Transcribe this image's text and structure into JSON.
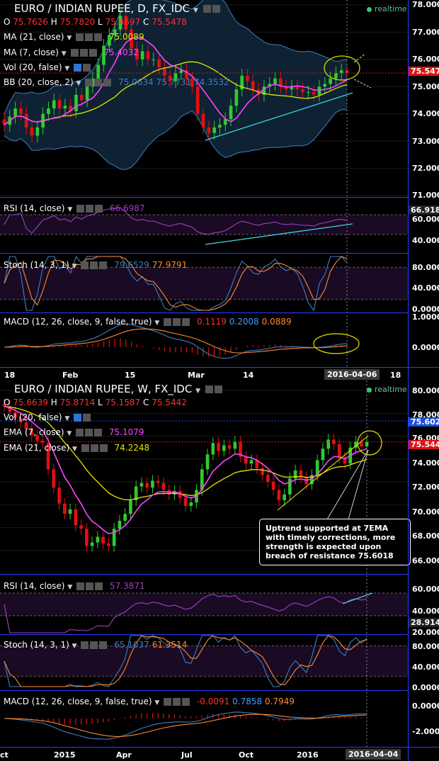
{
  "daily": {
    "title": "EURO / INDIAN RUPEE, D, FX_IDC",
    "realtime": "realtime",
    "ohlc": {
      "o_label": "O",
      "o": "75.7626",
      "h_label": "H",
      "h": "75.7820",
      "l_label": "L",
      "l": "75.4697",
      "c_label": "C",
      "c": "75.5478"
    },
    "indicators": [
      {
        "label": "MA (21, close)",
        "value": "75.0089",
        "color": "#e6e600"
      },
      {
        "label": "MA (7, close)",
        "value": "75.4032",
        "color": "#ff44ff"
      },
      {
        "label": "Vol (20, false)",
        "value": "",
        "color": "#aaaaaa"
      },
      {
        "label": "BB (20, close, 2)",
        "values": [
          "75.0634",
          "75.7731",
          "74.3532"
        ],
        "color": "#3f7fc0"
      }
    ],
    "price_ticks": [
      "78.0000",
      "77.0000",
      "76.0000",
      "75.0000",
      "74.0000",
      "73.0000",
      "72.0000",
      "71.0000"
    ],
    "last_price": "75.5478",
    "rsi": {
      "label": "RSI (14, close)",
      "value": "66.6987",
      "tag": "66.9189",
      "ticks": [
        "60.0000",
        "40.0000"
      ]
    },
    "stoch": {
      "label": "Stoch (14, 3, 1)",
      "values": [
        "79.6529",
        "77.9791"
      ],
      "ticks": [
        "80.0000",
        "40.0000",
        "0.0000"
      ]
    },
    "macd": {
      "label": "MACD (12, 26, close, 9, false, true)",
      "values": [
        "0.1119",
        "0.2008",
        "0.0889"
      ],
      "ticks": [
        "1.0000",
        "0.0000"
      ]
    },
    "x_ticks": [
      "18",
      "Feb",
      "15",
      "Mar",
      "14",
      "18"
    ],
    "date_box": "2016-04-06"
  },
  "weekly": {
    "title": "EURO / INDIAN RUPEE, W, FX_IDC",
    "realtime": "realtime",
    "ohlc": {
      "o_label": "O",
      "o": "75.6639",
      "h_label": "H",
      "h": "75.8714",
      "l_label": "L",
      "l": "75.1587",
      "c_label": "C",
      "c": "75.5442"
    },
    "indicators": [
      {
        "label": "Vol (20, false)",
        "value": "",
        "color": "#aaaaaa"
      },
      {
        "label": "EMA (7, close)",
        "value": "75.1079",
        "color": "#ff44ff"
      },
      {
        "label": "EMA (21, close)",
        "value": "74.2248",
        "color": "#e6e600"
      }
    ],
    "price_ticks": [
      "80.0000",
      "78.0000",
      "76.0000",
      "74.0000",
      "72.0000",
      "70.0000",
      "68.0000",
      "66.0000"
    ],
    "resistance": "75.6021",
    "last_price": "75.5442",
    "annotation": "Uptrend supported at 7EMA with timely corrections, more strength is expected upon breach of resistance 75.6018",
    "rsi": {
      "label": "RSI (14, close)",
      "value": "57.3871",
      "tag": "28.9146",
      "ticks": [
        "60.0000",
        "40.0000",
        "20.0000"
      ]
    },
    "stoch": {
      "label": "Stoch (14, 3, 1)",
      "values": [
        "65.1037",
        "61.3514"
      ],
      "ticks": [
        "80.0000",
        "40.0000",
        "0.0000"
      ]
    },
    "macd": {
      "label": "MACD (12, 26, close, 9, false, true)",
      "values": [
        "-0.0091",
        "0.7858",
        "0.7949"
      ],
      "ticks": [
        "0.0000",
        "-2.0000"
      ]
    },
    "x_ticks": [
      "ct",
      "2015",
      "Apr",
      "Jul",
      "Oct",
      "2016"
    ],
    "date_box": "2016-04-04"
  },
  "chart_data": [
    {
      "type": "candlestick",
      "title": "EURO / INDIAN RUPEE, D, FX_IDC",
      "ylim": [
        71,
        78
      ],
      "x_ticks": [
        "18",
        "Feb",
        "15",
        "Mar",
        "14",
        "18"
      ],
      "close": [
        73.6,
        73.9,
        74.2,
        74.0,
        73.5,
        73.2,
        73.5,
        74.0,
        74.2,
        74.5,
        74.2,
        74.3,
        74.1,
        74.7,
        74.5,
        75.0,
        75.3,
        75.8,
        76.5,
        76.9,
        77.1,
        77.6,
        77.1,
        76.4,
        76.0,
        76.3,
        76.0,
        76.0,
        75.7,
        75.4,
        75.2,
        75.5,
        75.6,
        75.3,
        75.0,
        74.0,
        73.5,
        73.3,
        73.5,
        73.6,
        73.8,
        74.3,
        74.9,
        75.4,
        75.2,
        74.9,
        74.7,
        75.0,
        75.1,
        75.3,
        75.0,
        74.9,
        75.0,
        74.9,
        74.8,
        74.8,
        74.7,
        75.0,
        75.1,
        75.3,
        75.5,
        75.6,
        75.5
      ]
    },
    {
      "type": "candlestick",
      "title": "EURO / INDIAN RUPEE, W, FX_IDC",
      "ylim": [
        65,
        80
      ],
      "x_ticks": [
        "ct",
        "2015",
        "Apr",
        "Jul",
        "Oct",
        "2016"
      ],
      "close": [
        78.6,
        78.1,
        77.6,
        77.2,
        76.6,
        76.1,
        75.6,
        75.4,
        73.1,
        71.5,
        70.1,
        69.2,
        69.6,
        68.2,
        67.9,
        66.4,
        66.7,
        67.2,
        66.6,
        66.4,
        67.9,
        68.6,
        69.2,
        70.4,
        71.6,
        71.9,
        71.5,
        72.1,
        71.9,
        71.3,
        70.9,
        71.2,
        70.6,
        69.9,
        70.2,
        71.3,
        73.1,
        74.4,
        75.4,
        74.7,
        75.2,
        74.9,
        75.5,
        74.2,
        73.6,
        73.9,
        73.2,
        72.6,
        72.0,
        71.3,
        70.4,
        70.9,
        72.3,
        73.0,
        72.4,
        71.8,
        72.6,
        73.9,
        74.9,
        75.7,
        75.3,
        74.1,
        73.6,
        75.0,
        75.5,
        75.1,
        75.5
      ]
    }
  ]
}
